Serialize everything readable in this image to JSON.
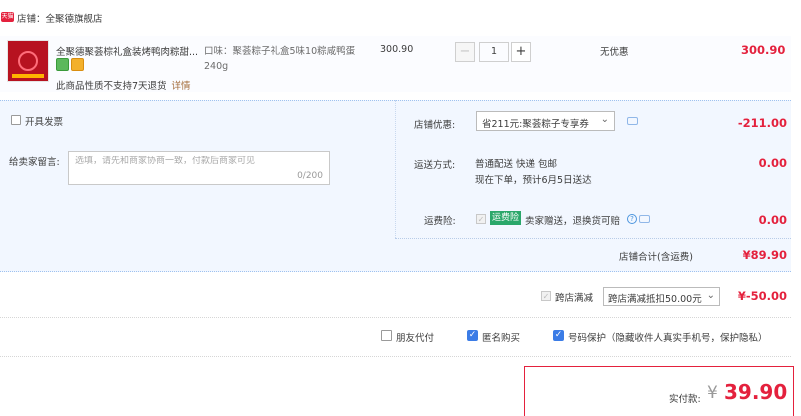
{
  "store": {
    "tag": "天猫",
    "label": "店铺：全聚德旗舰店"
  },
  "product": {
    "title": "全聚德聚荟棕礼盒装烤鸭肉粽甜...",
    "no_return_notice": "此商品性质不支持7天退货",
    "detail_link": "详情",
    "sku_text": "口味：聚荟粽子礼盒5味10粽咸鸭蛋240g",
    "price": "300.90",
    "quantity": "1",
    "minus": "−",
    "plus": "+",
    "discount_text": "无优惠",
    "subtotal": "300.90"
  },
  "invoice": {
    "label": "开具发票"
  },
  "message": {
    "label": "给卖家留言:",
    "placeholder": "选填，请先和商家协商一致，付款后商家可见",
    "counter": "0/200"
  },
  "coupon": {
    "label": "店铺优惠:",
    "selected": "省211元:聚荟粽子专享券",
    "amount": "-211.00"
  },
  "shipping": {
    "label": "运送方式:",
    "line1": "普通配送 快递 包邮",
    "line2": "现在下单，预计6月5日送达",
    "amount": "0.00"
  },
  "insurance": {
    "label": "运费险:",
    "badge": "运费险",
    "text": "卖家赠送，退换货可赔",
    "amount": "0.00"
  },
  "store_total": {
    "label": "店铺合计(含运费)",
    "amount": "¥89.90"
  },
  "cross_store": {
    "label": "跨店满减",
    "selected": "跨店满减抵扣50.00元",
    "amount": "¥-50.00"
  },
  "options": {
    "friend_pay": "朋友代付",
    "anonymous": "匿名购买",
    "number_protect": "号码保护（隐藏收件人真实手机号，保护隐私）"
  },
  "payment": {
    "label": "实付款:",
    "currency": "¥",
    "amount": "39.90"
  },
  "colors": {
    "accent_red": "#e4213d",
    "checkbox_blue": "#3b7ce6",
    "panel_blue": "#f2f7ff"
  }
}
